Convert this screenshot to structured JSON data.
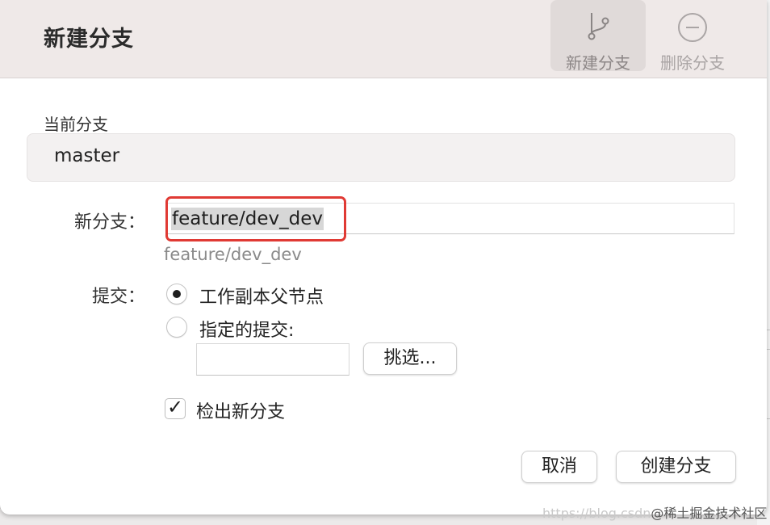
{
  "window": {
    "title": "新建分支"
  },
  "toolbar": {
    "new_branch": {
      "label": "新建分支",
      "icon": "branch-icon"
    },
    "delete_branch": {
      "label": "删除分支",
      "icon": "minus-circle-icon"
    }
  },
  "current_branch": {
    "label": "当前分支",
    "value": "master"
  },
  "new_branch": {
    "label": "新分支：",
    "value": "feature/dev_dev",
    "preview": "feature/dev_dev"
  },
  "commit": {
    "label": "提交：",
    "options": [
      {
        "label": "工作副本父节点",
        "selected": true
      },
      {
        "label": "指定的提交:",
        "selected": false
      }
    ],
    "pick_button": "挑选...",
    "specified_value": ""
  },
  "checkout": {
    "label": "检出新分支",
    "checked": true
  },
  "actions": {
    "cancel": "取消",
    "create": "创建分支"
  },
  "watermark": {
    "part1": "https://blog.csdn",
    "part2": "@稀土掘金技术社区"
  },
  "colors": {
    "highlight": "#e03a34",
    "toolbar_bg": "#efe9e8"
  }
}
